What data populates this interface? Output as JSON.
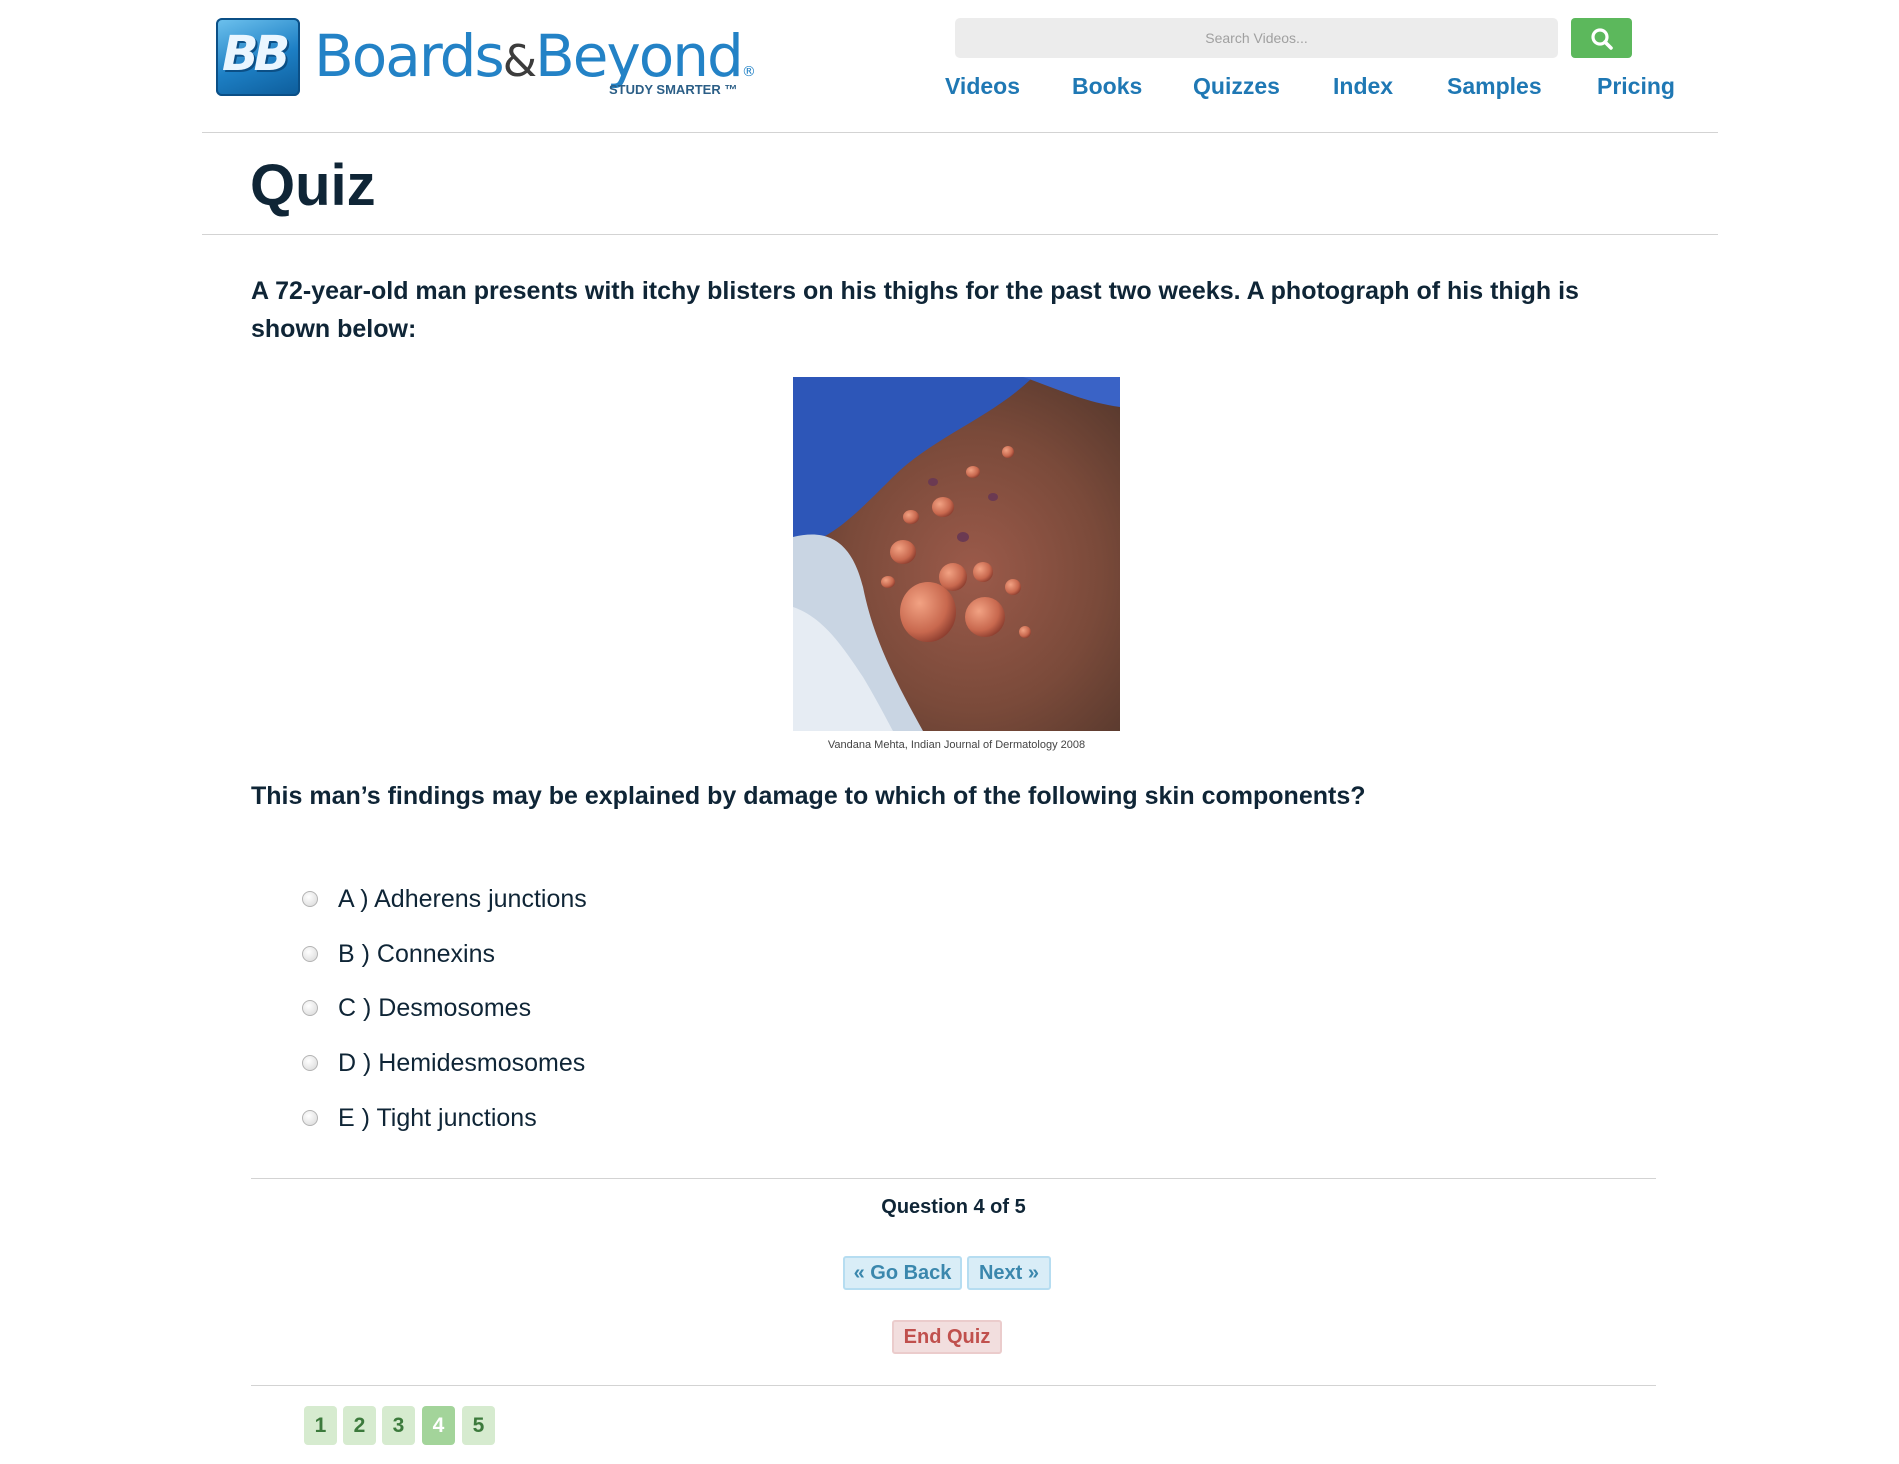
{
  "brand": {
    "badge": "BB",
    "name_part1": "Boards",
    "amp": "&",
    "name_part2": "Beyond",
    "registered": "®",
    "tagline": "STUDY SMARTER ™"
  },
  "search": {
    "placeholder": "Search Videos..."
  },
  "nav": {
    "items": [
      {
        "label": "Videos"
      },
      {
        "label": "Books"
      },
      {
        "label": "Quizzes"
      },
      {
        "label": "Index"
      },
      {
        "label": "Samples"
      },
      {
        "label": "Pricing"
      }
    ]
  },
  "page": {
    "title": "Quiz"
  },
  "question": {
    "stem": "A 72-year-old man presents with itchy blisters on his thighs for the past two weeks. A photograph of his thigh is shown below:",
    "image_caption": "Vandana Mehta, Indian Journal of Dermatology 2008",
    "prompt": "This man’s findings may be explained by damage to which of the following skin components?",
    "options": [
      {
        "label": "A ) Adherens junctions"
      },
      {
        "label": "B ) Connexins"
      },
      {
        "label": "C ) Desmosomes"
      },
      {
        "label": "D ) Hemidesmosomes"
      },
      {
        "label": "E ) Tight junctions"
      }
    ]
  },
  "progress": {
    "text": "Question 4 of 5",
    "current": 4,
    "total": 5
  },
  "buttons": {
    "back": "« Go Back",
    "next": "Next »",
    "end": "End Quiz"
  },
  "pagination": {
    "pages": [
      "1",
      "2",
      "3",
      "4",
      "5"
    ]
  },
  "colors": {
    "brand_blue": "#2382c6",
    "nav_link": "#1f78b4",
    "search_button": "#5cb85c",
    "nav_button_bg": "#d9edf7",
    "end_button_bg": "#f2dede",
    "page_pill": "#d6ebcf",
    "page_pill_current": "#a3d49a"
  },
  "icons": {
    "search": "search-icon"
  }
}
